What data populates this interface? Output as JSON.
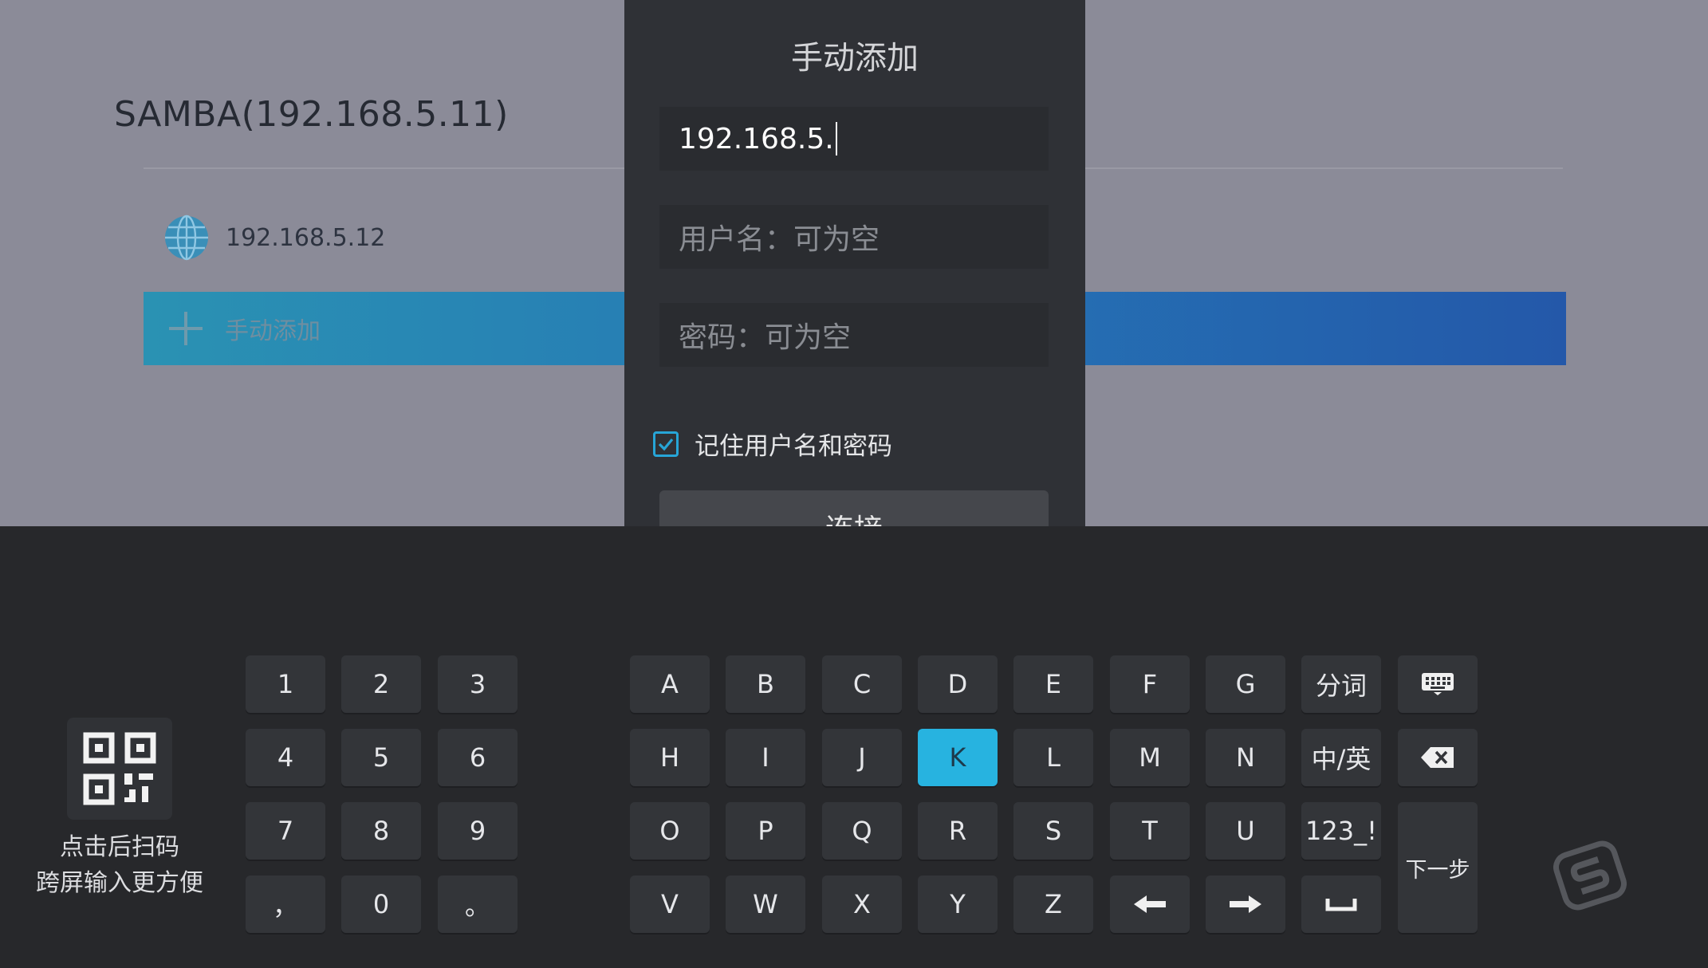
{
  "background": {
    "title": "SAMBA(192.168.5.11)",
    "host_item": "192.168.5.12",
    "add_item": "手动添加"
  },
  "dialog": {
    "title": "手动添加",
    "ip_value": "192.168.5.",
    "username_placeholder": "用户名：可为空",
    "password_placeholder": "密码：可为空",
    "remember_label": "记住用户名和密码",
    "remember_checked": true,
    "connect_label": "连接"
  },
  "keyboard": {
    "numpad": [
      "1",
      "2",
      "3",
      "4",
      "5",
      "6",
      "7",
      "8",
      "9",
      "，",
      "0",
      "。"
    ],
    "letters_row1": [
      "A",
      "B",
      "C",
      "D",
      "E",
      "F",
      "G"
    ],
    "letters_row2": [
      "H",
      "I",
      "J",
      "K",
      "L",
      "M",
      "N"
    ],
    "letters_row3": [
      "O",
      "P",
      "Q",
      "R",
      "S",
      "T",
      "U"
    ],
    "letters_row4": [
      "V",
      "W",
      "X",
      "Y",
      "Z"
    ],
    "segment_label": "分词",
    "lang_label": "中/英",
    "symbols_label": "123_!",
    "next_label": "下一步",
    "selected_key": "K",
    "qr_hint_line1": "点击后扫码",
    "qr_hint_line2": "跨屏输入更方便",
    "accent_color": "#27b3e0"
  }
}
